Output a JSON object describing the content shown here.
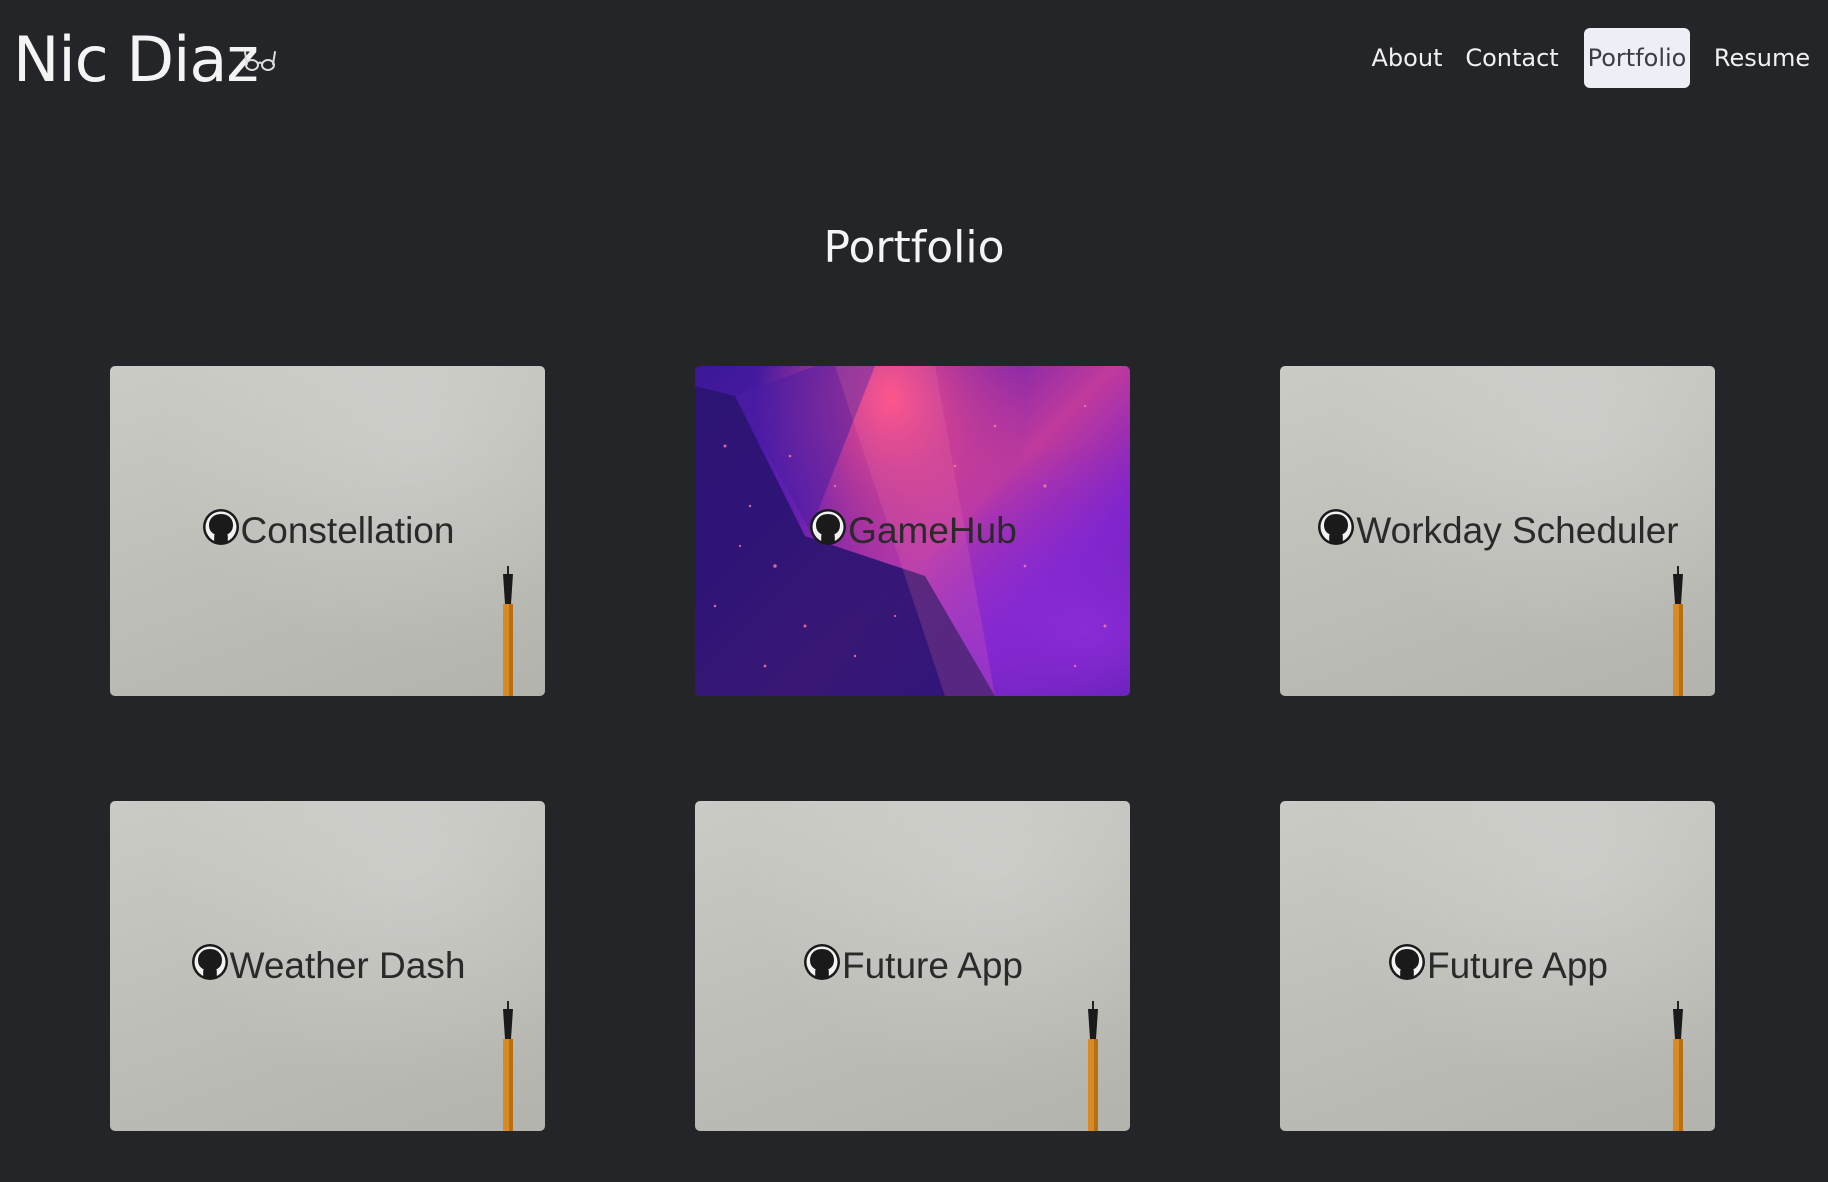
{
  "brand": {
    "name": "Nic Diaz",
    "icon": "glasses-icon"
  },
  "nav": {
    "items": [
      {
        "label": "About",
        "active": false
      },
      {
        "label": "Contact",
        "active": false
      },
      {
        "label": "Portfolio",
        "active": true
      },
      {
        "label": "Resume",
        "active": false
      }
    ]
  },
  "portfolio": {
    "title": "Portfolio",
    "projects": [
      {
        "title": "Constellation",
        "icon": "github-icon"
      },
      {
        "title": "GameHub",
        "icon": "github-icon"
      },
      {
        "title": "Workday Scheduler",
        "icon": "github-icon"
      },
      {
        "title": "Weather Dash",
        "icon": "github-icon"
      },
      {
        "title": "Future App",
        "icon": "github-icon"
      },
      {
        "title": "Future App",
        "icon": "github-icon"
      }
    ]
  },
  "colors": {
    "background": "#232528",
    "active_nav_bg": "#eceff5",
    "card_text": "#2a2a2a"
  }
}
